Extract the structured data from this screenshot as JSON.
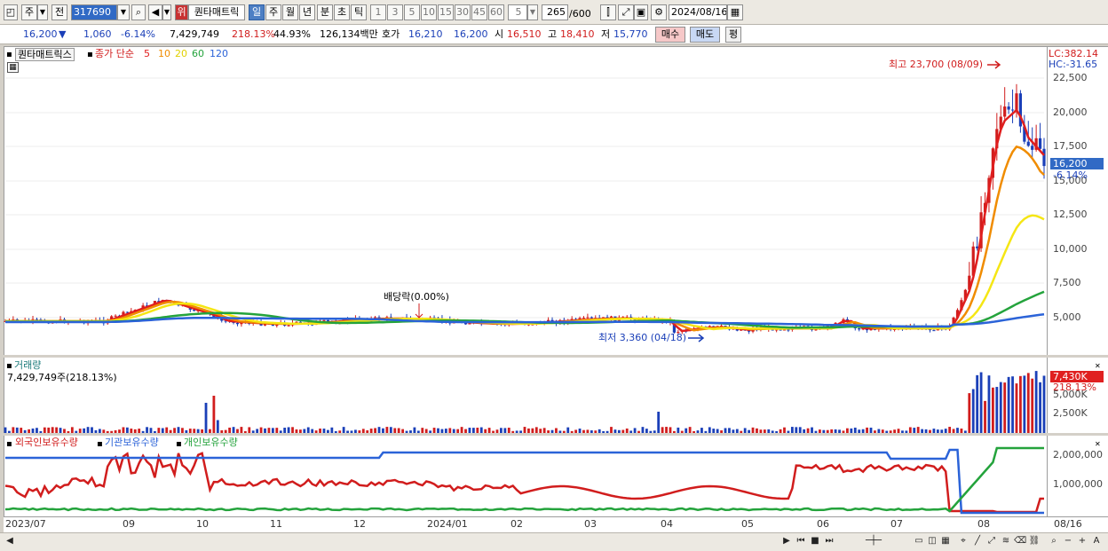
{
  "toolbar": {
    "period_prefix": "주",
    "prev_label": "전",
    "code": "317690",
    "stock_tag": "위",
    "stock_name": "퀀타매트릭",
    "period_tabs": [
      "일",
      "주",
      "월",
      "년",
      "분",
      "초",
      "틱"
    ],
    "active_period": "일",
    "intervals": [
      "1",
      "3",
      "5",
      "10",
      "15",
      "30",
      "45",
      "60"
    ],
    "interval_select": "5",
    "count": "265",
    "count_max": "/600",
    "date": "2024/08/16"
  },
  "quote": {
    "price": "16,200",
    "change": "1,060",
    "change_pct": "-6.14%",
    "volume": "7,429,749",
    "volume_ratio": "218.13%",
    "turnover": "44.93%",
    "amount": "126,134백만",
    "bid_label": "호가",
    "bid1": "16,210",
    "bid2": "16,200",
    "open_label": "시",
    "open": "16,510",
    "high_label": "고",
    "high": "18,410",
    "low_label": "저",
    "low": "15,770",
    "buy_button": "매수",
    "sell_button": "매도",
    "eval_button": "평"
  },
  "price_panel": {
    "name": "퀀타매트릭스",
    "ma_label": "종가 단순",
    "ma_periods": [
      "5",
      "10",
      "20",
      "60",
      "120"
    ],
    "ma_colors": [
      "#e01e1e",
      "#f08c00",
      "#f5e614",
      "#24a33c",
      "#2b63d8"
    ],
    "high_note": "최고 23,700 (08/09)",
    "low_note": "최저 3,360 (04/18)",
    "dividend_note": "배당락(0.00%)",
    "lc": "LC:382.14",
    "hc": "HC:-31.65",
    "yticks": [
      "22,500",
      "20,000",
      "17,500",
      "15,000",
      "12,500",
      "10,000",
      "7,500",
      "5,000"
    ],
    "current_price": "16,200",
    "current_pct": "-6.14%"
  },
  "volume_panel": {
    "name": "거래량",
    "value": "7,429,749주(218.13%)",
    "current": "7,430K",
    "current_pct": "218.13%",
    "yticks": [
      "5,000K",
      "2,500K"
    ]
  },
  "holding_panel": {
    "legend": [
      "외국인보유수량",
      "기관보유수량",
      "개인보유수량"
    ],
    "legend_colors": [
      "#d11d1d",
      "#2b63d8",
      "#24a33c"
    ],
    "yticks": [
      "2,000,000",
      "1,000,000"
    ]
  },
  "xaxis": {
    "labels": [
      "2023/07",
      "09",
      "10",
      "11",
      "12",
      "2024/01",
      "02",
      "03",
      "04",
      "05",
      "06",
      "07",
      "08"
    ],
    "end_label": "08/16"
  },
  "colors": {
    "up": "#d11d1d",
    "down": "#1a3fb8",
    "accent": "#316ac5"
  }
}
